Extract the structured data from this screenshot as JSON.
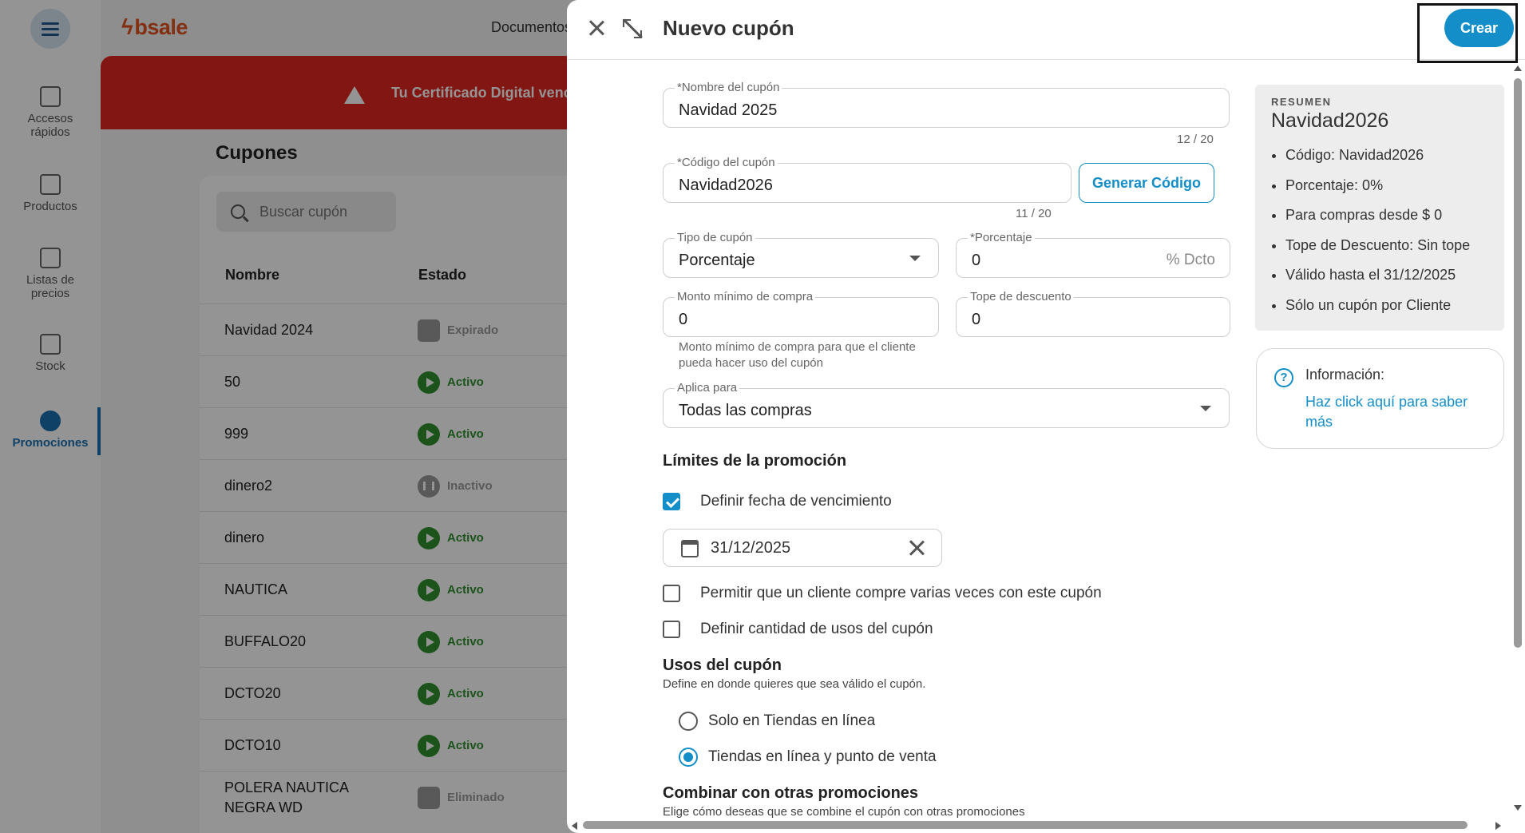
{
  "app": {
    "logo": "bsale",
    "topnav_label": "Documentos"
  },
  "sidebar": {
    "items": [
      {
        "label": "Accesos rápidos"
      },
      {
        "label": "Productos"
      },
      {
        "label": "Listas de precios"
      },
      {
        "label": "Stock"
      },
      {
        "label": "Promociones"
      }
    ]
  },
  "alert": {
    "text": "Tu Certificado Digital vence pronto"
  },
  "coupons_page": {
    "title": "Cupones",
    "search_placeholder": "Buscar cupón",
    "columns": [
      "Nombre",
      "Estado"
    ],
    "rows": [
      {
        "name": "Navidad 2024",
        "status": "Expirado"
      },
      {
        "name": "50",
        "status": "Activo"
      },
      {
        "name": "999",
        "status": "Activo"
      },
      {
        "name": "dinero2",
        "status": "Inactivo"
      },
      {
        "name": "dinero",
        "status": "Activo"
      },
      {
        "name": "NAUTICA",
        "status": "Activo"
      },
      {
        "name": "BUFFALO20",
        "status": "Activo"
      },
      {
        "name": "DCTO20",
        "status": "Activo"
      },
      {
        "name": "DCTO10",
        "status": "Activo"
      },
      {
        "name": "POLERA NAUTICA NEGRA WD",
        "status": "Eliminado"
      }
    ]
  },
  "drawer": {
    "title": "Nuevo cupón",
    "create_button": "Crear",
    "fields": {
      "name": {
        "label": "*Nombre del cupón",
        "value": "Navidad 2025",
        "counter": "12 / 20"
      },
      "code": {
        "label": "*Código del cupón",
        "value": "Navidad2026",
        "counter": "11 / 20",
        "generate_button": "Generar Código"
      },
      "type": {
        "label": "Tipo de cupón",
        "value": "Porcentaje"
      },
      "percentage": {
        "label": "*Porcentaje",
        "value": "0",
        "suffix": "% Dcto"
      },
      "min_amount": {
        "label": "Monto mínimo de compra",
        "value": "0",
        "helper": "Monto mínimo de compra para que el cliente pueda hacer uso del cupón"
      },
      "max_discount": {
        "label": "Tope de descuento",
        "value": "0"
      },
      "applies_to": {
        "label": "Aplica para",
        "value": "Todas las compras"
      }
    },
    "limits": {
      "title": "Límites de la promoción",
      "expiry_checkbox": {
        "label": "Definir fecha de vencimiento",
        "checked": true
      },
      "expiry_date": "31/12/2025",
      "multi_use_checkbox": {
        "label": "Permitir que un cliente compre varias veces con este cupón",
        "checked": false
      },
      "usage_count_checkbox": {
        "label": "Definir cantidad de usos del cupón",
        "checked": false
      }
    },
    "usage": {
      "title": "Usos del cupón",
      "subtitle": "Define en donde quieres que sea válido el cupón.",
      "options": [
        {
          "label": "Solo en Tiendas en línea",
          "selected": false
        },
        {
          "label": "Tiendas en línea y punto de venta",
          "selected": true
        }
      ]
    },
    "combine": {
      "title": "Combinar con otras promociones",
      "subtitle": "Elige cómo deseas que se combine el cupón con otras promociones"
    },
    "summary": {
      "caption": "RESUMEN",
      "title": "Navidad2026",
      "items": [
        "Código: Navidad2026",
        "Porcentaje: 0%",
        "Para compras desde $ 0",
        "Tope de Descuento: Sin tope",
        "Válido hasta el 31/12/2025",
        "Sólo un cupón por Cliente"
      ]
    },
    "info": {
      "title": "Información:",
      "link": "Haz click aquí para saber más"
    }
  },
  "colors": {
    "accent": "#138ec9",
    "alert": "#e0261f",
    "active": "#2f8f2f",
    "brand": "#e2531f"
  }
}
